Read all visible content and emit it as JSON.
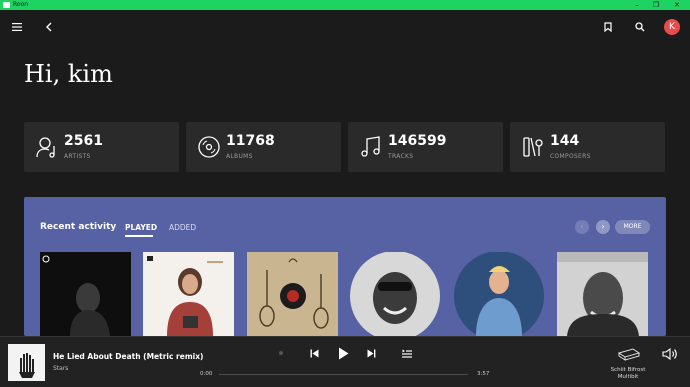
{
  "window": {
    "title": "Roon"
  },
  "header": {
    "avatar_letter": "K"
  },
  "greeting": "Hi, kim",
  "stats": [
    {
      "value": "2561",
      "label": "ARTISTS",
      "icon": "artist-icon"
    },
    {
      "value": "11768",
      "label": "ALBUMS",
      "icon": "album-icon"
    },
    {
      "value": "146599",
      "label": "TRACKS",
      "icon": "music-note-icon"
    },
    {
      "value": "144",
      "label": "COMPOSERS",
      "icon": "composer-icon"
    }
  ],
  "recent": {
    "title": "Recent activity",
    "tabs": [
      "PLAYED",
      "ADDED"
    ],
    "more_label": "MORE"
  },
  "player": {
    "song": "He Lied About Death (Metric remix)",
    "artist": "Stars",
    "elapsed": "0:00",
    "duration": "3:57",
    "progress": 0,
    "zone_line1": "Schiit Bifrost",
    "zone_line2": "Multibit"
  },
  "colors": {
    "accent": "#1fd362",
    "recent_bg": "#5762a4",
    "avatar": "#e84b4b"
  }
}
